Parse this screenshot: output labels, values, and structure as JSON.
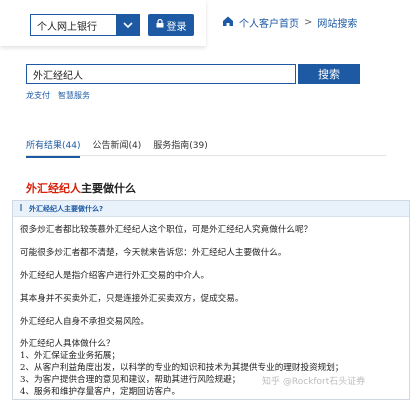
{
  "header": {
    "bank_select_value": "个人网上银行",
    "login_label": "登录",
    "breadcrumb": [
      "个人客户首页",
      ">",
      "网站搜索"
    ]
  },
  "search": {
    "value": "外汇经纪人",
    "button_label": "搜索",
    "quick_links": [
      "龙支付",
      "智慧服务"
    ]
  },
  "tabs": [
    {
      "label": "所有结果(44)",
      "active": true
    },
    {
      "label": "公告新闻(4)",
      "active": false
    },
    {
      "label": "服务指南(39)",
      "active": false
    }
  ],
  "result": {
    "title_highlight": "外汇经纪人",
    "title_rest": "主要做什么",
    "frame_title": "外汇经纪人主要做什么?",
    "lines": [
      "很多炒汇者都比较羡慕外汇经纪人这个职位，可是外汇经纪人究竟做什么呢？",
      "可能很多炒汇者都不清楚，今天就来告诉您：外汇经纪人主要做什么。",
      "外汇经纪人是指介绍客户进行外汇交易的中介人。",
      "其本身并不买卖外汇，只是连接外汇买卖双方，促成交易。",
      "外汇经纪人自身不承担交易风险。",
      "外汇经纪人具体做什么？",
      "1、外汇保证金业务拓展；",
      "2、从客户利益角度出发，以科学的专业的知识和技术为其提供专业的理财投资规划；",
      "3、为客户提供合理的意见和建议，帮助其进行风险规避；",
      "4、服务和维护存量客户，定期回访客户。"
    ]
  },
  "watermark": "知乎 @Rockfort石头证券",
  "colors": {
    "brand_blue": "#1d5aa3",
    "highlight_red": "#d81e06"
  }
}
